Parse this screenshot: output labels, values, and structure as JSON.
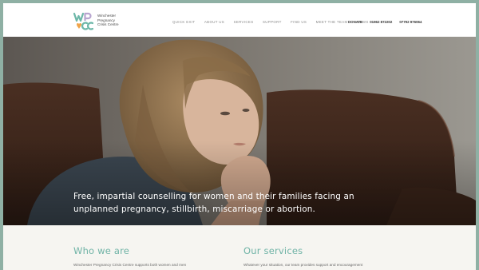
{
  "logo": {
    "mark": "WPCC",
    "lines": [
      "Winchester",
      "Pregnancy",
      "Crisis Centre"
    ],
    "colors": {
      "teal": "#6cb7a8",
      "orange": "#f0a44a",
      "lilac": "#b7a4cf"
    }
  },
  "nav": {
    "items": [
      "QUICK EXIT",
      "ABOUT US",
      "SERVICES",
      "SUPPORT",
      "FIND US",
      "MEET THE TEAM",
      "NEWS"
    ]
  },
  "right_links": {
    "items": [
      "DONATE",
      "01962 872202",
      "07792 976064"
    ]
  },
  "hero": {
    "caption": "Free, impartial counselling for women and their families facing an unplanned pregnancy, stillbirth, miscarriage or abortion."
  },
  "sections": {
    "who_we_are": {
      "title": "Who we are",
      "text": "Winchester Pregnancy Crisis Centre supports both women and men"
    },
    "our_services": {
      "title": "Our services",
      "text": "Whatever your situation, our team provides support and encouragement"
    }
  },
  "colors": {
    "frame": "#8fb0a4",
    "accent_teal": "#6fb3a6",
    "content_bg": "#f6f5f1"
  }
}
